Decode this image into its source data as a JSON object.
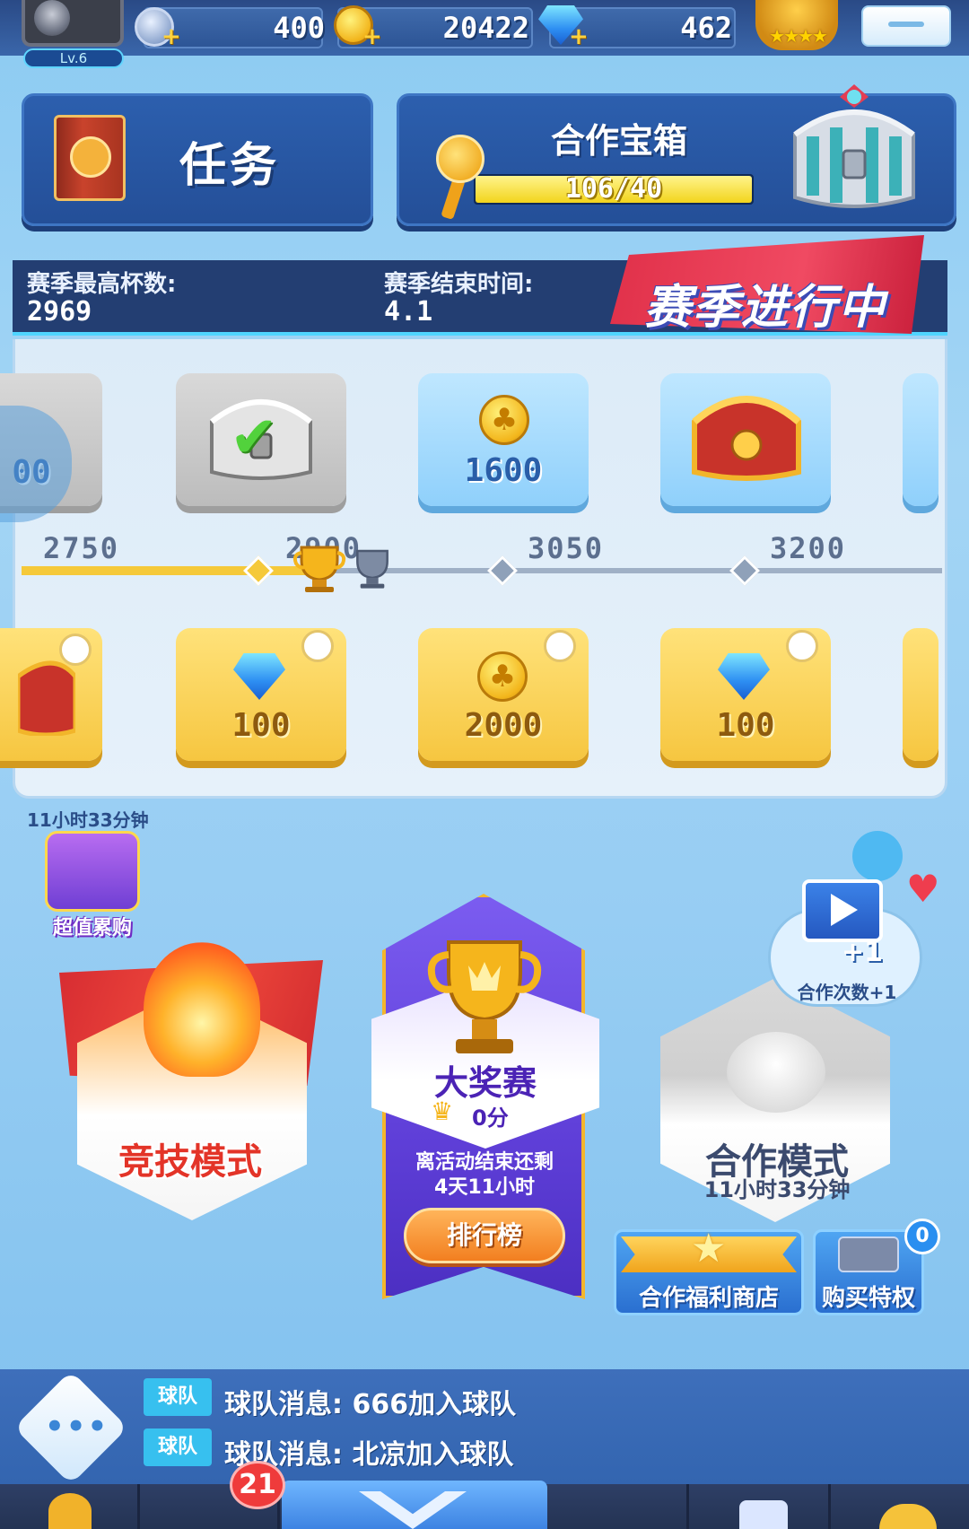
{
  "top_bar": {
    "level": "Lv.6",
    "stars_value": "400",
    "gold_value": "20422",
    "gems_value": "462",
    "stars_icon": "star-coin-icon",
    "gold_icon": "clover-coin-icon",
    "gem_icon": "diamond-icon"
  },
  "task": {
    "label": "任务"
  },
  "coop_chest": {
    "title": "合作宝箱",
    "progress_text": "106/40",
    "progress_fraction": 1.0
  },
  "season": {
    "max_cups_label": "赛季最高杯数:",
    "max_cups_value": "2969",
    "end_time_label": "赛季结束时间:",
    "end_time_value": "4.1",
    "status": "赛季进行中"
  },
  "reward_track": {
    "milestones": [
      "2750",
      "2900",
      "3050",
      "3200"
    ],
    "top_rewards": [
      {
        "type": "partial",
        "value": "00"
      },
      {
        "type": "silver-chest",
        "value": ""
      },
      {
        "type": "coins",
        "value": "1600"
      },
      {
        "type": "gold-chest",
        "value": ""
      }
    ],
    "bottom_rewards": [
      {
        "type": "red-chest",
        "value": ""
      },
      {
        "type": "gems",
        "value": "100"
      },
      {
        "type": "coins",
        "value": "2000"
      },
      {
        "type": "gems",
        "value": "100"
      }
    ]
  },
  "offer": {
    "timer": "11小时33分钟",
    "label": "超值累购"
  },
  "modes": {
    "arena": {
      "label": "竞技模式"
    },
    "grand_prix": {
      "title": "大奖赛",
      "score": "0分",
      "remain_line1": "离活动结束还剩",
      "remain_line2": "4天11小时",
      "rank_button": "排行榜"
    },
    "coop": {
      "label": "合作模式",
      "timer": "11小时33分钟",
      "bubble_text": "合作次数+1",
      "plus_one": "+1"
    }
  },
  "shop": {
    "coop_shop_label": "合作福利商店",
    "buy_privilege_label": "购买特权",
    "badge_count": "0"
  },
  "chat": {
    "messages": [
      {
        "tag": "球队",
        "text": "球队消息: 666加入球队"
      },
      {
        "tag": "球队",
        "text": "球队消息: 北凉加入球队"
      }
    ]
  },
  "nav": {
    "badge_count": "21"
  }
}
